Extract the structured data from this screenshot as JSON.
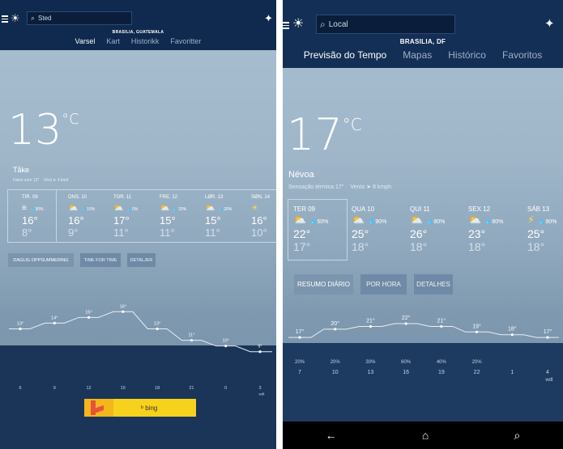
{
  "left": {
    "search_placeholder": "Sted",
    "location": "BRASILIA, GUATEMALA",
    "tabs": [
      {
        "label": "Varsel"
      },
      {
        "label": "Kart"
      },
      {
        "label": "Historikk"
      },
      {
        "label": "Favoritter"
      }
    ],
    "current": {
      "temp": "13",
      "unit": "°C",
      "condition": "Tåke",
      "feels_label": "Føles som",
      "feels_value": "13°",
      "wind_label": "Vind",
      "wind_value": "4 km/t"
    },
    "forecast": [
      {
        "day": "TIR. 09",
        "icon": "fog",
        "precip": "30%",
        "high": "16°",
        "low": "8°"
      },
      {
        "day": "ONS. 10",
        "icon": "partly-cloudy",
        "precip": "10%",
        "high": "16°",
        "low": "9°"
      },
      {
        "day": "TOR. 11",
        "icon": "partly-cloudy",
        "precip": "0%",
        "high": "17°",
        "low": "11°"
      },
      {
        "day": "FRE. 12",
        "icon": "partly-cloudy",
        "precip": "20%",
        "high": "15°",
        "low": "11°"
      },
      {
        "day": "LØR. 13",
        "icon": "partly-cloudy",
        "precip": "20%",
        "high": "15°",
        "low": "11°"
      },
      {
        "day": "SØN. 14",
        "icon": "sunny",
        "precip": "",
        "high": "16°",
        "low": "10°"
      }
    ],
    "buttons": [
      {
        "label": "DAGLIG OPPSUMMERING"
      },
      {
        "label": "TIME FOR TIME"
      },
      {
        "label": "DETALJER"
      }
    ],
    "bing_label": "bing",
    "chart_data": {
      "type": "line",
      "x": [
        "6",
        "9",
        "12",
        "15",
        "18",
        "21",
        "0",
        "3"
      ],
      "xlabel": "wdt",
      "series": [
        {
          "values": [
            13,
            14,
            15,
            16,
            13,
            11,
            10,
            9
          ]
        }
      ],
      "labels": [
        "13°",
        "14°",
        "15°",
        "16°",
        "13°",
        "11°",
        "10°",
        "9°"
      ],
      "ylim": [
        5,
        20
      ]
    }
  },
  "right": {
    "search_placeholder": "Local",
    "location": "BRASILIA, DF",
    "tabs": [
      {
        "label": "Previsão do Tempo"
      },
      {
        "label": "Mapas"
      },
      {
        "label": "Histórico"
      },
      {
        "label": "Favoritos"
      }
    ],
    "current": {
      "temp": "17",
      "unit": "°C",
      "condition": "Névoa",
      "feels_label": "Sensação térmica",
      "feels_value": "17°",
      "wind_label": "Vento",
      "wind_value": "8 kmph"
    },
    "forecast": [
      {
        "day": "TER 09",
        "icon": "partly-cloudy",
        "precip": "50%",
        "high": "22°",
        "low": "17°"
      },
      {
        "day": "QUA 10",
        "icon": "partly-cloudy",
        "precip": "90%",
        "high": "25°",
        "low": "18°"
      },
      {
        "day": "QUI 11",
        "icon": "partly-cloudy",
        "precip": "80%",
        "high": "26°",
        "low": "18°"
      },
      {
        "day": "SEX 12",
        "icon": "partly-cloudy",
        "precip": "80%",
        "high": "23°",
        "low": "18°"
      },
      {
        "day": "SÁB 13",
        "icon": "thunderstorm",
        "precip": "90%",
        "high": "25°",
        "low": "18°"
      }
    ],
    "buttons": [
      {
        "label": "RESUMO DIÁRIO"
      },
      {
        "label": "POR HORA"
      },
      {
        "label": "DETALHES"
      }
    ],
    "chart_data": {
      "type": "line",
      "x": [
        "7",
        "10",
        "13",
        "16",
        "19",
        "22",
        "1",
        "4"
      ],
      "xlabel": "wdt",
      "series": [
        {
          "values": [
            17,
            20,
            21,
            22,
            21,
            19,
            18,
            17
          ]
        }
      ],
      "labels": [
        "17°",
        "20°",
        "21°",
        "22°",
        "21°",
        "19°",
        "18°",
        "17°"
      ],
      "precip": [
        "20%",
        "20%",
        "30%",
        "60%",
        "40%",
        "20%",
        "",
        ""
      ],
      "ylim": [
        10,
        27
      ]
    }
  }
}
